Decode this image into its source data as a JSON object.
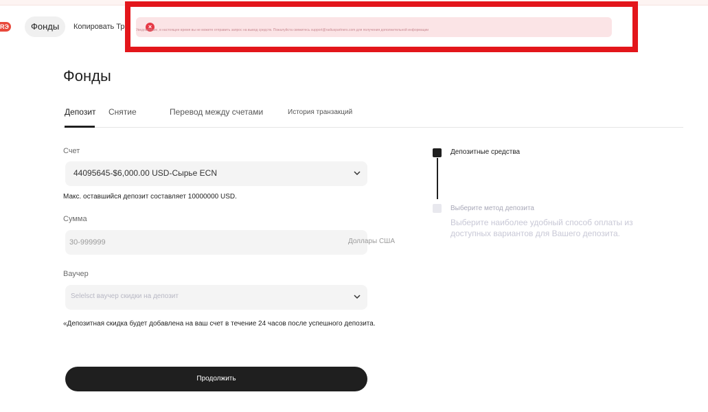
{
  "header": {
    "brand_badge": "RЭ",
    "nav": {
      "funds_label": "Фонды",
      "copy_label": "Копировать Трей"
    }
  },
  "alert": {
    "icon": "error-icon",
    "text": "Уведомление, в настоящее время вы не можете отправить запрос на вывод средств. Пожалуйста свяжитесь support@radiuspartners.com для получения дополнительной информации"
  },
  "page": {
    "title": "Фонды"
  },
  "tabs": [
    {
      "label": "Депозит",
      "active": true
    },
    {
      "label": "Снятие",
      "active": false
    },
    {
      "label": "Перевод между счетами",
      "active": false
    },
    {
      "label": "История транзакций",
      "active": false
    }
  ],
  "form": {
    "account": {
      "label": "Счет",
      "value": "44095645-$6,000.00 USD-Сырье ECN"
    },
    "max_deposit_note": "Макс. оставшийся депозит составляет 10000000 USD.",
    "amount": {
      "label": "Сумма",
      "placeholder": "30-999999",
      "unit": "Доллары США"
    },
    "voucher": {
      "label": "Ваучер",
      "placeholder": "Selelsct ваучер скидки на депозит"
    },
    "voucher_note": "«Депозитная скидка будет добавлена на ваш счет в течение 24 часов после успешного депозита.",
    "continue_label": "Продолжить"
  },
  "steps": [
    {
      "icon": "wallet-icon",
      "title": "Депозитные средства",
      "state": "active"
    },
    {
      "icon": "card-icon",
      "title": "Выберите метод депозита",
      "state": "pending",
      "description": "Выберите наиболее удобный способ оплаты из доступных вариантов для Вашего депозита."
    }
  ],
  "colors": {
    "alert_border": "#e3161b",
    "alert_bg": "#fbe4e6",
    "alert_icon": "#e63946",
    "primary_button": "#1f1f1f",
    "brand": "#e8493b"
  }
}
